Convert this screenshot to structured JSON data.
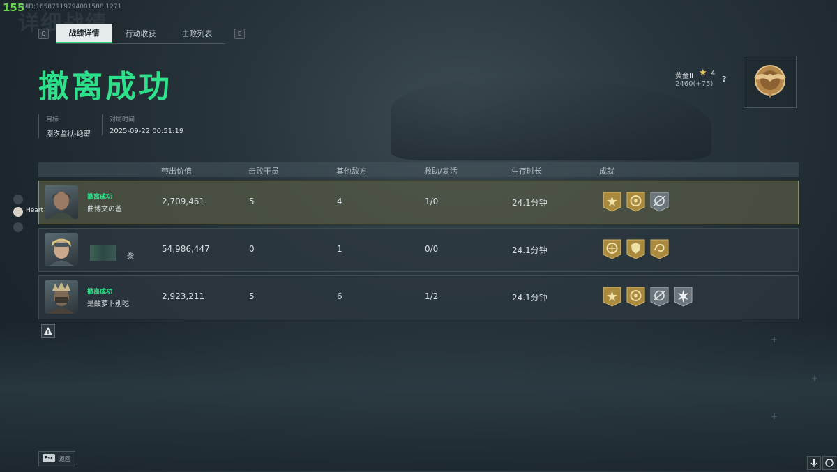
{
  "hud": {
    "fps": "155",
    "uid": "UID:16587119794001588 1271"
  },
  "header": {
    "ghost_title": "详细战绩",
    "key_left": "Q",
    "key_right": "E",
    "tabs": [
      {
        "label": "战绩详情",
        "active": true
      },
      {
        "label": "行动收获",
        "active": false
      },
      {
        "label": "击败列表",
        "active": false
      }
    ]
  },
  "result": {
    "title": "撤离成功",
    "target_label": "目标",
    "target_value": "潮汐监狱-绝密",
    "time_label": "对局时间",
    "time_value": "2025-09-22 00:51:19"
  },
  "rank": {
    "name": "黄金II",
    "stars": "4",
    "score": "2460(+75)",
    "help": "?",
    "badge_icon": "gold-eagle-rank-badge"
  },
  "table": {
    "headers": [
      "带出价值",
      "击败干员",
      "其他敌方",
      "救助/复活",
      "生存时长",
      "成就"
    ],
    "rows": [
      {
        "status": "撤离成功",
        "name": "曲博文の爸",
        "value": "2,709,461",
        "kills": "5",
        "others": "4",
        "assist": "1/0",
        "survival": "24.1分钟",
        "highlight": true,
        "achievements": [
          "gold-star-medal",
          "gold-circle-medal",
          "silver-crosshair-medal"
        ]
      },
      {
        "status": "",
        "name": "柴",
        "value": "54,986,447",
        "kills": "0",
        "others": "1",
        "assist": "0/0",
        "survival": "24.1分钟",
        "highlight": false,
        "achievements": [
          "gold-circle-medal",
          "gold-shield-medal",
          "gold-swirl-medal"
        ]
      },
      {
        "status": "撤离成功",
        "name": "是酸萝卜别吃",
        "value": "2,923,211",
        "kills": "5",
        "others": "6",
        "assist": "1/2",
        "survival": "24.1分钟",
        "highlight": false,
        "achievements": [
          "gold-star-medal",
          "gold-circle-medal",
          "silver-crosshair-medal",
          "silver-burst-medal"
        ]
      }
    ]
  },
  "side": {
    "heart_label": "Heart"
  },
  "footer": {
    "esc_key": "Esc",
    "esc_label": "返回"
  },
  "colors": {
    "accent": "#2fe08a",
    "gold": "#c9a24a",
    "silver": "#8a949a"
  }
}
